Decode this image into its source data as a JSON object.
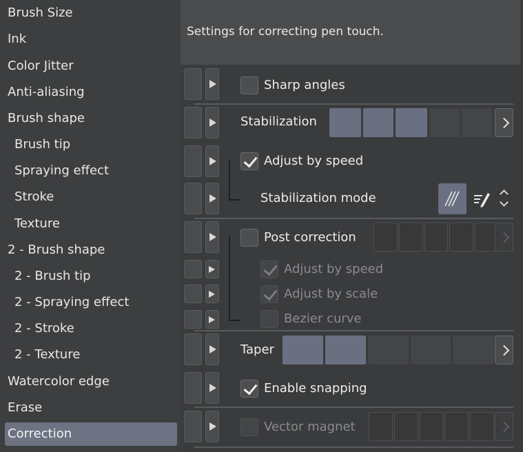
{
  "sidebar": {
    "items": [
      {
        "label": "Brush Size"
      },
      {
        "label": "Ink"
      },
      {
        "label": "Color Jitter"
      },
      {
        "label": "Anti-aliasing"
      },
      {
        "label": "Brush shape"
      },
      {
        "label": "Brush tip"
      },
      {
        "label": "Spraying effect"
      },
      {
        "label": "Stroke"
      },
      {
        "label": "Texture"
      },
      {
        "label": "2 - Brush shape"
      },
      {
        "label": "2 - Brush tip"
      },
      {
        "label": "2 - Spraying effect"
      },
      {
        "label": "2 - Stroke"
      },
      {
        "label": "2 - Texture"
      },
      {
        "label": "Watercolor edge"
      },
      {
        "label": "Erase"
      },
      {
        "label": "Correction"
      }
    ],
    "active": "Correction"
  },
  "main": {
    "description": "Settings for correcting pen touch.",
    "sharp_angles": {
      "label": "Sharp angles",
      "checked": false
    },
    "stabilization": {
      "label": "Stabilization",
      "level": 3,
      "max": 5
    },
    "adjust_by_speed": {
      "label": "Adjust by speed",
      "checked": true
    },
    "stabilization_mode": {
      "label": "Stabilization mode",
      "selected": "smooth-lines-icon"
    },
    "post_correction": {
      "label": "Post correction",
      "checked": false
    },
    "post_adjust_by_speed": {
      "label": "Adjust by speed",
      "checked": true,
      "enabled": false
    },
    "post_adjust_by_scale": {
      "label": "Adjust by scale",
      "checked": true,
      "enabled": false
    },
    "bezier_curve": {
      "label": "Bezier curve",
      "checked": false,
      "enabled": false
    },
    "taper": {
      "label": "Taper",
      "level": 2,
      "max": 5
    },
    "enable_snapping": {
      "label": "Enable snapping",
      "checked": true
    },
    "vector_magnet": {
      "label": "Vector magnet",
      "checked": false,
      "enabled": false
    }
  },
  "colors": {
    "accent": "#6a7082",
    "background": "#3a3b3c",
    "sidebar_active": "#6d7383"
  }
}
